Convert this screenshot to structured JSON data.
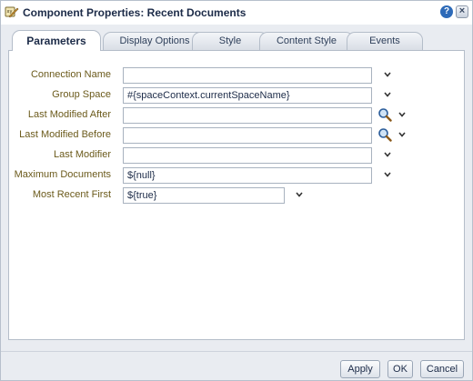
{
  "title": "Component Properties: Recent Documents",
  "tabs": [
    {
      "label": "Parameters",
      "active": true
    },
    {
      "label": "Display Options",
      "active": false
    },
    {
      "label": "Style",
      "active": false
    },
    {
      "label": "Content Style",
      "active": false
    },
    {
      "label": "Events",
      "active": false
    }
  ],
  "fields": [
    {
      "label": "Connection Name",
      "value": ""
    },
    {
      "label": "Group Space",
      "value": "#{spaceContext.currentSpaceName}"
    },
    {
      "label": "Last Modified After",
      "value": ""
    },
    {
      "label": "Last Modified Before",
      "value": ""
    },
    {
      "label": "Last Modifier",
      "value": ""
    },
    {
      "label": "Maximum Documents",
      "value": "${null}"
    },
    {
      "label": "Most Recent First",
      "value": "${true}"
    }
  ],
  "buttons": {
    "apply": "Apply",
    "ok": "OK",
    "cancel": "Cancel"
  },
  "icons": {
    "title": "component-edit-icon",
    "help": "help-icon",
    "close": "close-icon",
    "dropdown": "chevron-down-icon",
    "search": "search-icon"
  },
  "colors": {
    "label": "#6b5a1b",
    "accent": "#2d6ab8"
  }
}
